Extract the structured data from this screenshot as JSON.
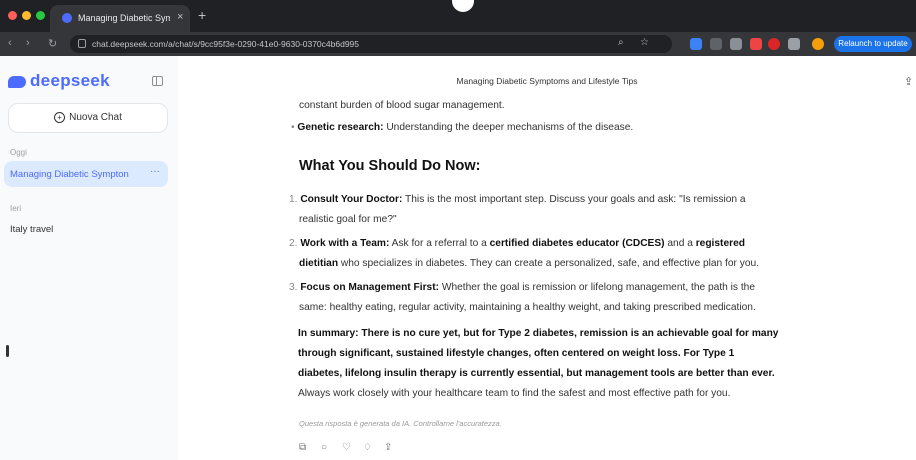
{
  "browser": {
    "tab_title": "Managing Diabetic Sympton",
    "tab_close": "×",
    "new_tab": "+",
    "url": "chat.deepseek.com/a/chat/s/9cc95f3e-0290-41e0-9630-0370c4b6d995",
    "relaunch_label": "Relaunch to update",
    "back": "‹",
    "forward": "›",
    "reload": "↻"
  },
  "sidebar": {
    "logo": "deepseek",
    "new_chat_label": "Nuova Chat",
    "groups": [
      {
        "label": "Oggi",
        "items": [
          {
            "title": "Managing Diabetic Sympton",
            "active": true,
            "more": "···"
          }
        ]
      },
      {
        "label": "Ieri",
        "items": [
          {
            "title": "Italy travel",
            "active": false
          }
        ]
      }
    ]
  },
  "main": {
    "title": "Managing Diabetic Symptoms and Lifestyle Tips",
    "lines": {
      "l1": "constant burden of blood sugar management.",
      "l2_bold": "Genetic research:",
      "l2_rest": " Understanding the deeper mechanisms of the disease.",
      "heading": "What You Should Do Now:",
      "i1_bold": "Consult Your Doctor:",
      "i1_rest": " This is the most important step. Discuss your goals and ask: \"Is remission a",
      "i1_cont": "realistic goal for me?\"",
      "i2_bold": "Work with a Team:",
      "i2_rest": " Ask for a referral to a ",
      "i2_bold2": "certified diabetes educator (CDCES)",
      "i2_rest2": " and a ",
      "i2_bold3": "registered",
      "i2_cont_bold": "dietitian",
      "i2_cont_rest": " who specializes in diabetes. They can create a personalized, safe, and effective plan for you.",
      "i3_bold": "Focus on Management First:",
      "i3_rest": " Whether the goal is remission or lifelong management, the path is the",
      "i3_cont": "same: healthy eating, regular activity, maintaining a healthy weight, and taking prescribed medication.",
      "s1": "In summary: There is no cure yet, but for Type 2 diabetes, remission is an achievable goal for many",
      "s2": "through significant, sustained lifestyle changes, often centered on weight loss. For Type 1",
      "s3": "diabetes, lifelong insulin therapy is currently essential, but management tools are better than ever.",
      "s4": "Always work closely with your healthcare team to find the safest and most effective path for you."
    },
    "disclaimer": "Questa risposta è generata da IA. Controllarne l'accuratezza."
  }
}
